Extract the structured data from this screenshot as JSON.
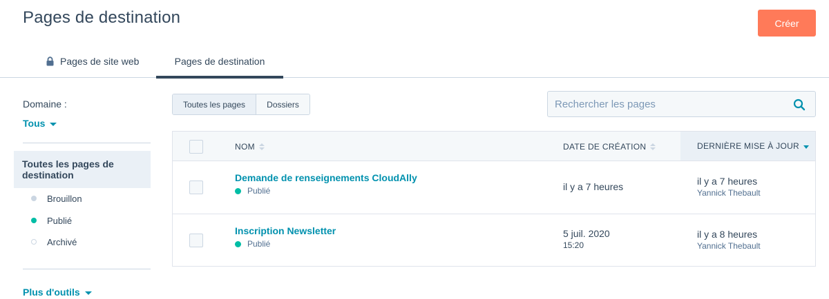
{
  "header": {
    "title": "Pages de destination",
    "create_label": "Créer"
  },
  "tabs": [
    {
      "label": "Pages de site web",
      "icon": "lock-icon",
      "active": false
    },
    {
      "label": "Pages de destination",
      "active": true
    }
  ],
  "sidebar": {
    "domain_label": "Domaine :",
    "domain_value": "Tous",
    "all_pages_label": "Toutes les pages de destination",
    "statuses": [
      {
        "label": "Brouillon",
        "color": "#cbd6e2"
      },
      {
        "label": "Publié",
        "color": "#00bda5"
      },
      {
        "label": "Archivé",
        "color": "#cbd6e2"
      }
    ],
    "more_tools_label": "Plus d'outils"
  },
  "view_toggle": {
    "all_pages": "Toutes les pages",
    "folders": "Dossiers"
  },
  "search": {
    "placeholder": "Rechercher les pages"
  },
  "table": {
    "columns": {
      "name": "NOM",
      "created": "DATE DE CRÉATION",
      "updated": "DERNIÈRE MISE À JOUR"
    },
    "rows": [
      {
        "name": "Demande de renseignements CloudAlly",
        "status": "Publié",
        "created": "il y a 7 heures",
        "created_time": "",
        "updated": "il y a 7 heures",
        "author": "Yannick Thebault"
      },
      {
        "name": "Inscription Newsletter",
        "status": "Publié",
        "created": "5 juil. 2020",
        "created_time": "15:20",
        "updated": "il y a 8 heures",
        "author": "Yannick Thebault"
      }
    ]
  },
  "colors": {
    "accent": "#ff7a59",
    "link": "#0091ae",
    "text": "#33475b",
    "published": "#00bda5"
  }
}
